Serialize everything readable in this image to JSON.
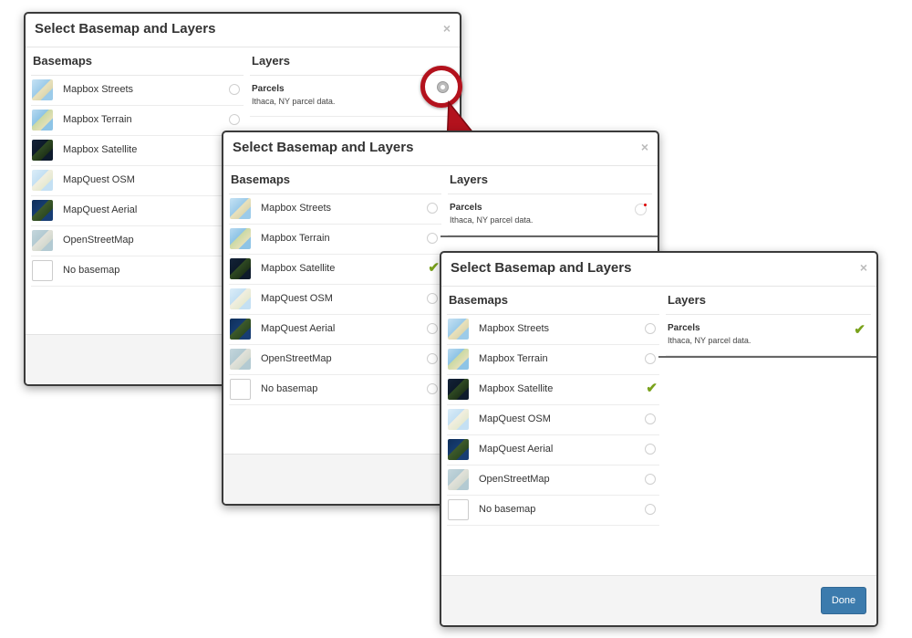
{
  "dialog_title": "Select Basemap and Layers",
  "close_glyph": "×",
  "basemaps_heading": "Basemaps",
  "layers_heading": "Layers",
  "basemaps": [
    {
      "label": "Mapbox Streets",
      "thumb": "streets"
    },
    {
      "label": "Mapbox Terrain",
      "thumb": "terrain"
    },
    {
      "label": "Mapbox Satellite",
      "thumb": "satellite"
    },
    {
      "label": "MapQuest OSM",
      "thumb": "mapquest-osm"
    },
    {
      "label": "MapQuest Aerial",
      "thumb": "mapquest-aerial"
    },
    {
      "label": "OpenStreetMap",
      "thumb": "openstreetmap"
    },
    {
      "label": "No basemap",
      "thumb": "none"
    }
  ],
  "layer": {
    "name": "Parcels",
    "description": "Ithaca, NY parcel data."
  },
  "selected_basemap": "Mapbox Satellite",
  "states": [
    {
      "step": 1,
      "layer_state": "unselected-highlighted"
    },
    {
      "step": 2,
      "layer_state": "loading"
    },
    {
      "step": 3,
      "layer_state": "selected"
    }
  ],
  "done_label": "Done",
  "colors": {
    "accent_check": "#7aa21c",
    "done_button": "#3c7bad",
    "highlight": "#b3121d"
  },
  "icons": {
    "check": "check-icon",
    "close": "close-icon",
    "pointer": "cursor-arrow-icon"
  }
}
